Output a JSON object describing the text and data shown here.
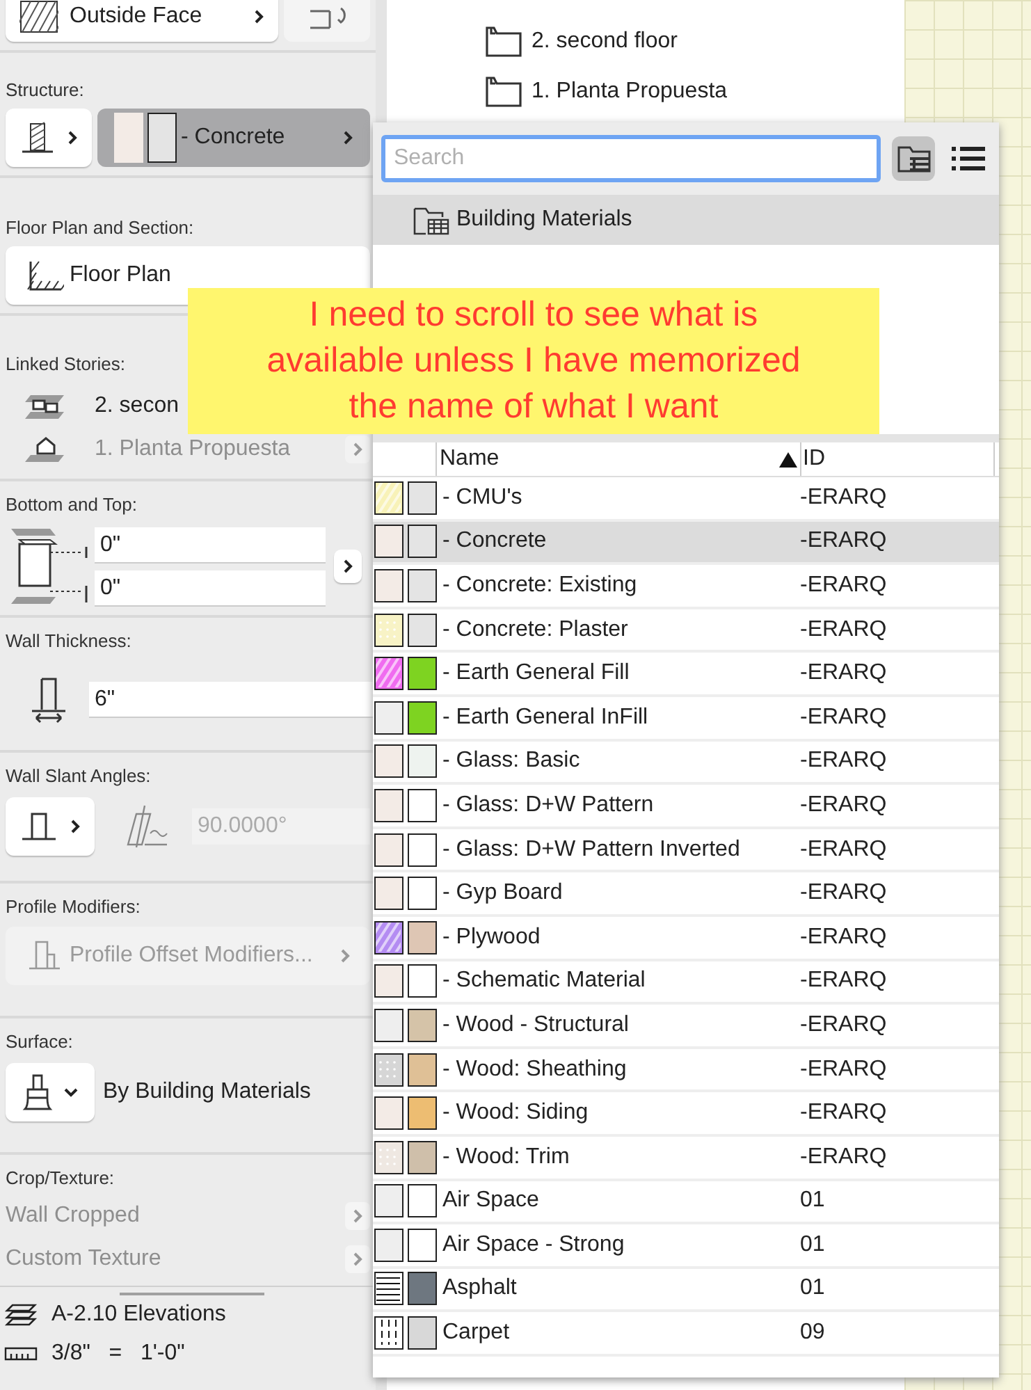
{
  "settings_panel": {
    "outside_face": {
      "label": "Outside Face"
    },
    "structure": {
      "heading": "Structure:",
      "material": "- Concrete",
      "selected": true
    },
    "floor_plan": {
      "heading": "Floor Plan and Section:",
      "value": "Floor Plan"
    },
    "linked_stories": {
      "heading": "Linked Stories:",
      "items": [
        {
          "label": "2. secon",
          "disabled": false
        },
        {
          "label": "1. Planta Propuesta",
          "disabled": true
        }
      ]
    },
    "bottom_top": {
      "heading": "Bottom and Top:",
      "fields": [
        "0\"",
        "0\""
      ]
    },
    "wall_thickness": {
      "heading": "Wall Thickness:",
      "value": "6\""
    },
    "slant": {
      "heading": "Wall Slant Angles:",
      "value": "90.0000°",
      "disabled": true
    },
    "profile": {
      "heading": "Profile Modifiers:",
      "button": "Profile Offset Modifiers...",
      "disabled": true
    },
    "surface": {
      "heading": "Surface:",
      "value": "By Building Materials"
    },
    "crop_texture": {
      "heading": "Crop/Texture:",
      "items": [
        {
          "label": "Wall Cropped",
          "disabled": true
        },
        {
          "label": "Custom Texture",
          "disabled": true
        }
      ]
    },
    "footer": [
      {
        "kind": "layer",
        "label": "A-2.10 Elevations"
      },
      {
        "kind": "scale",
        "label": "3/8\"   =   1'-0\""
      }
    ]
  },
  "navigator": {
    "stories": [
      {
        "label": "2. second floor"
      },
      {
        "label": "1. Planta Propuesta"
      }
    ]
  },
  "material_picker": {
    "search": {
      "placeholder": "Search"
    },
    "view_buttons": [
      {
        "kind": "folder",
        "selected": true
      },
      {
        "kind": "list",
        "selected": false
      }
    ],
    "folder": {
      "label": "Building Materials",
      "selected": true
    },
    "columns": [
      {
        "label": "Name",
        "sorted": true
      },
      {
        "label": "ID",
        "sorted": false
      }
    ],
    "rows": [
      {
        "name": "- CMU's",
        "id": "-ERARQ",
        "selected": false,
        "pattern": {
          "kind": "hatch",
          "color": "#f8f2b8"
        },
        "color": "#e4e4e4"
      },
      {
        "name": "- Concrete",
        "id": "-ERARQ",
        "selected": true,
        "pattern": {
          "kind": "plain",
          "color": "#f3ebe6"
        },
        "color": "#e4e4e4"
      },
      {
        "name": "- Concrete: Existing",
        "id": "-ERARQ",
        "selected": false,
        "pattern": {
          "kind": "plain",
          "color": "#f3ebe6"
        },
        "color": "#e4e4e4"
      },
      {
        "name": "- Concrete: Plaster",
        "id": "-ERARQ",
        "selected": false,
        "pattern": {
          "kind": "dots",
          "color": "#f8f3c6"
        },
        "color": "#e4e4e4"
      },
      {
        "name": "- Earth General Fill",
        "id": "-ERARQ",
        "selected": false,
        "pattern": {
          "kind": "hatch",
          "color": "#f06cf0"
        },
        "color": "#7ed321"
      },
      {
        "name": "- Earth General InFill",
        "id": "-ERARQ",
        "selected": false,
        "pattern": {
          "kind": "plain",
          "color": "#eeeeee"
        },
        "color": "#7ed321"
      },
      {
        "name": "- Glass: Basic",
        "id": "-ERARQ",
        "selected": false,
        "pattern": {
          "kind": "plain",
          "color": "#f3ebe6"
        },
        "color": "#eef3ef"
      },
      {
        "name": "- Glass: D+W Pattern",
        "id": "-ERARQ",
        "selected": false,
        "pattern": {
          "kind": "plain",
          "color": "#f3ebe6"
        },
        "color": "#ffffff"
      },
      {
        "name": "- Glass: D+W Pattern Inverted",
        "id": "-ERARQ",
        "selected": false,
        "pattern": {
          "kind": "plain",
          "color": "#f3ebe6"
        },
        "color": "#ffffff"
      },
      {
        "name": "- Gyp Board",
        "id": "-ERARQ",
        "selected": false,
        "pattern": {
          "kind": "plain",
          "color": "#f3ebe6"
        },
        "color": "#ffffff"
      },
      {
        "name": "- Plywood",
        "id": "-ERARQ",
        "selected": false,
        "pattern": {
          "kind": "hatch",
          "color": "#b48cf2"
        },
        "color": "#dec6b4"
      },
      {
        "name": "- Schematic Material",
        "id": "-ERARQ",
        "selected": false,
        "pattern": {
          "kind": "plain",
          "color": "#f3ebe6"
        },
        "color": "#ffffff"
      },
      {
        "name": "- Wood - Structural",
        "id": "-ERARQ",
        "selected": false,
        "pattern": {
          "kind": "plain",
          "color": "#eeeeee"
        },
        "color": "#d5c3a8"
      },
      {
        "name": "- Wood: Sheathing",
        "id": "-ERARQ",
        "selected": false,
        "pattern": {
          "kind": "dots",
          "color": "#d6d6d6"
        },
        "color": "#dfc096"
      },
      {
        "name": "- Wood: Siding",
        "id": "-ERARQ",
        "selected": false,
        "pattern": {
          "kind": "plain",
          "color": "#f3ebe6"
        },
        "color": "#edbd72"
      },
      {
        "name": "- Wood: Trim",
        "id": "-ERARQ",
        "selected": false,
        "pattern": {
          "kind": "dots",
          "color": "#efe8e2"
        },
        "color": "#cfbfaa"
      },
      {
        "name": "Air Space",
        "id": "01",
        "selected": false,
        "pattern": {
          "kind": "plain",
          "color": "#eeeeee"
        },
        "color": "#ffffff"
      },
      {
        "name": "Air Space - Strong",
        "id": "01",
        "selected": false,
        "pattern": {
          "kind": "plain",
          "color": "#eeeeee"
        },
        "color": "#ffffff"
      },
      {
        "name": "Asphalt",
        "id": "01",
        "selected": false,
        "pattern": {
          "kind": "lines",
          "color": "#ffffff"
        },
        "color": "#6e7780"
      },
      {
        "name": "Carpet",
        "id": "09",
        "selected": false,
        "pattern": {
          "kind": "bars",
          "color": "#ffffff"
        },
        "color": "#d8d8d8"
      }
    ]
  },
  "annotation": {
    "text": "I need to scroll to see what is available unless I have memorized the name of what I want"
  }
}
